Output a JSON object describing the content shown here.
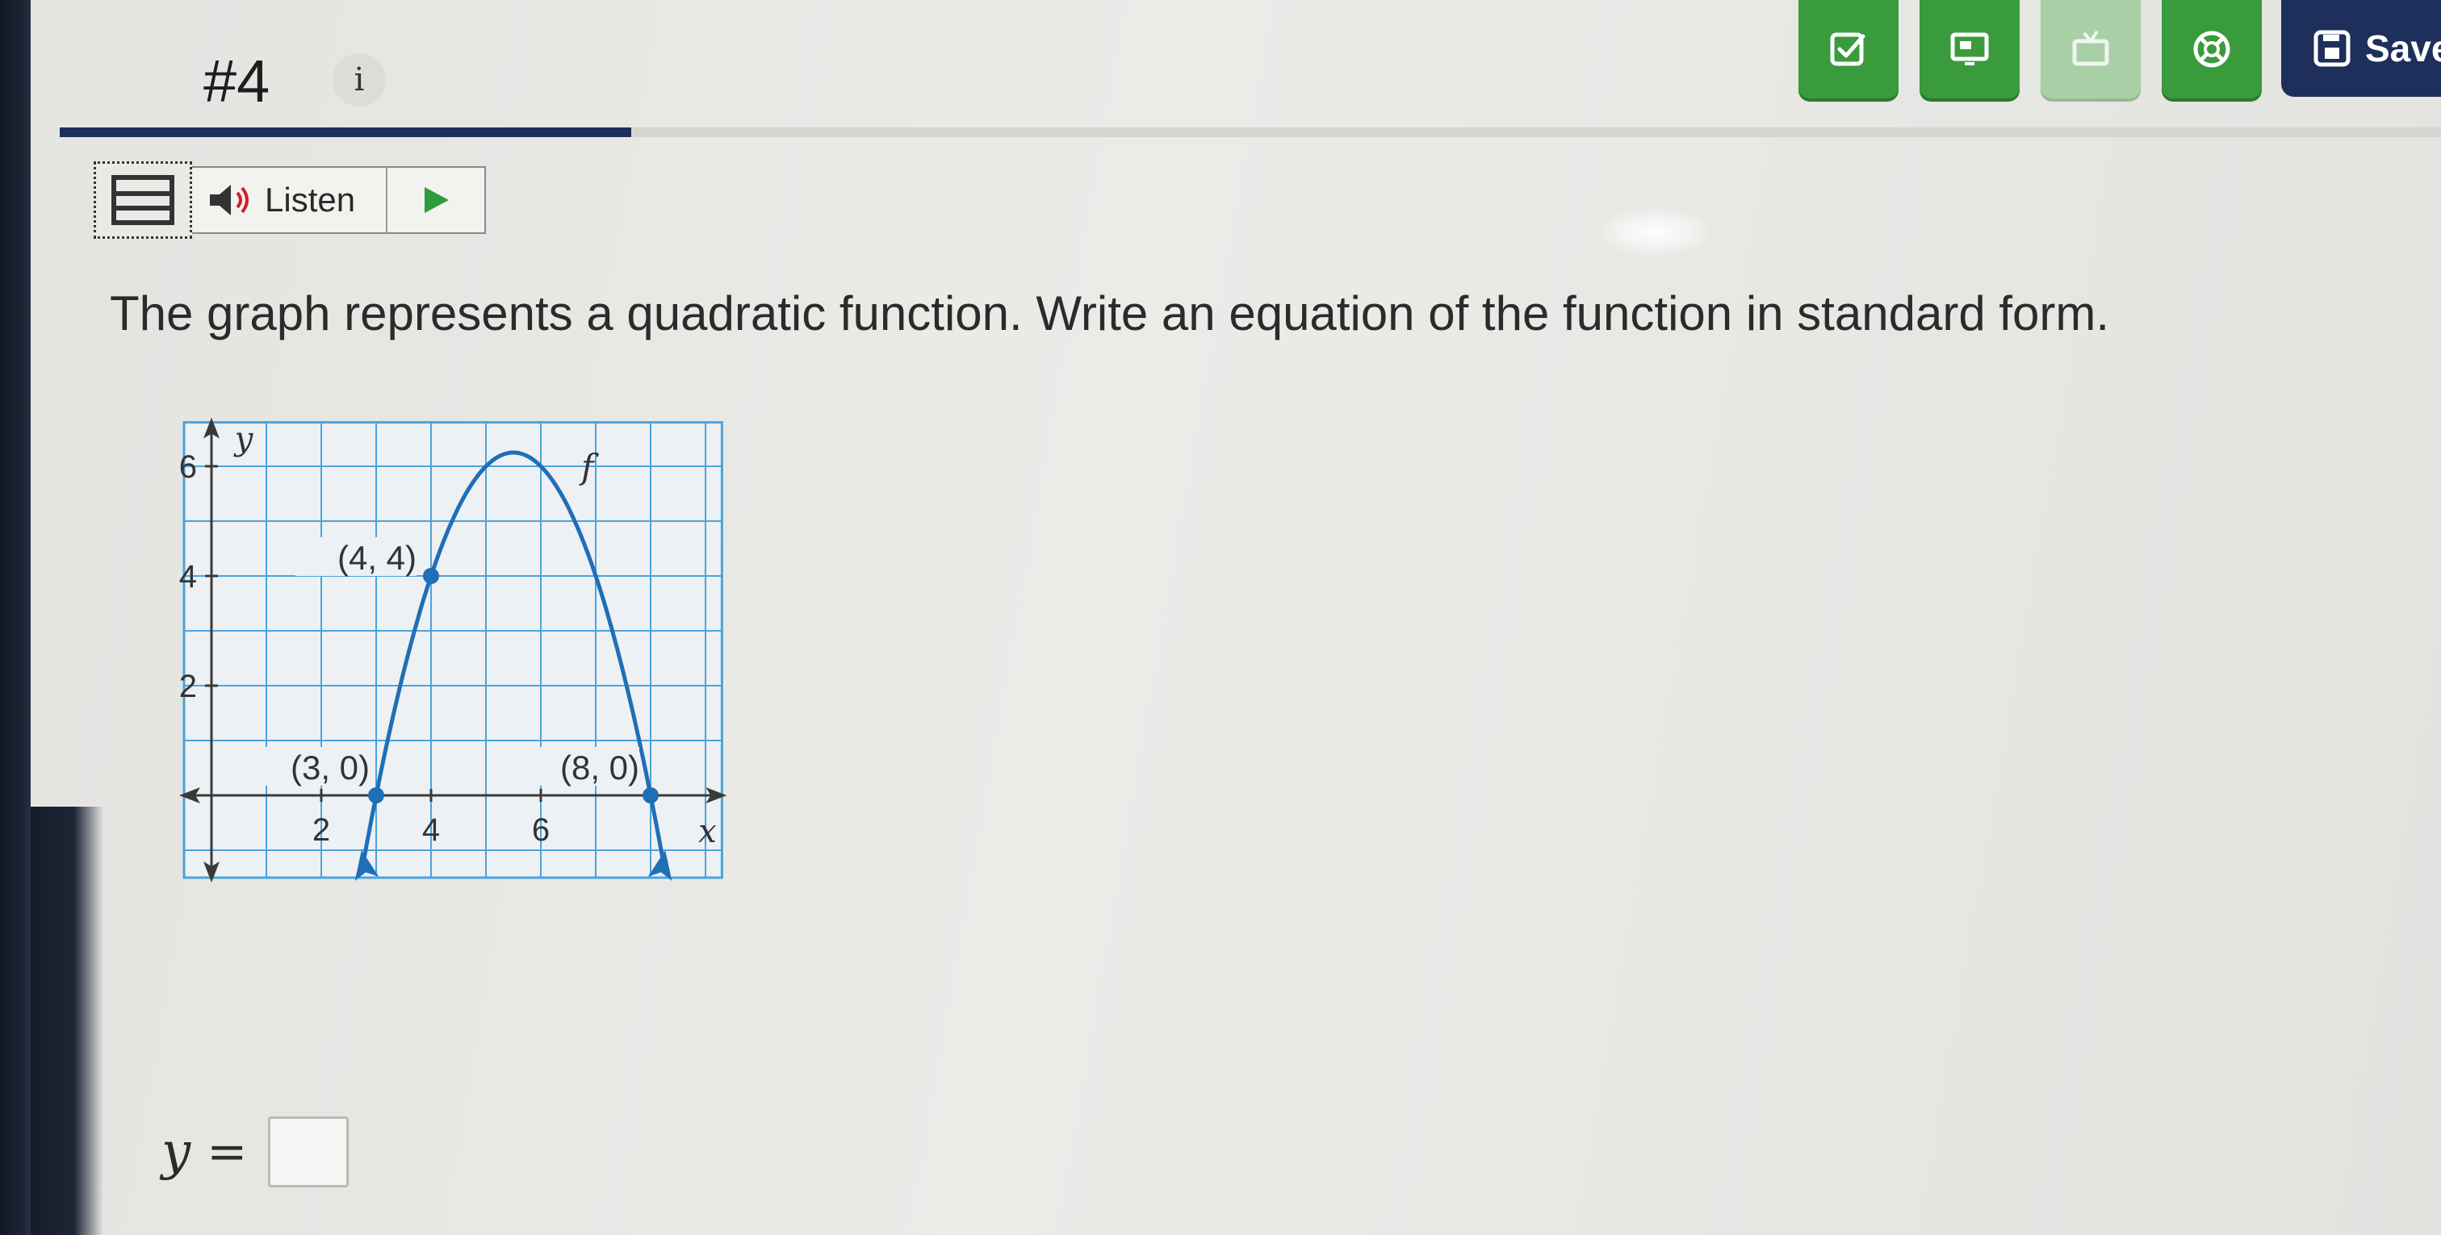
{
  "header": {
    "question_number": "#4",
    "info_badge": "i",
    "progress_fraction": 0.24,
    "tools": [
      {
        "name": "check-answer",
        "icon": "checkbox-icon",
        "enabled": true
      },
      {
        "name": "hint",
        "icon": "monitor-icon",
        "enabled": true
      },
      {
        "name": "video",
        "icon": "tv-icon",
        "enabled": false
      },
      {
        "name": "help",
        "icon": "lifebuoy-icon",
        "enabled": true
      }
    ],
    "save_label": "Save"
  },
  "listen": {
    "label": "Listen"
  },
  "question": {
    "text": "The graph represents a quadratic function. Write an equation of the function in standard form."
  },
  "graph": {
    "x_axis_label": "x",
    "y_axis_label": "y",
    "function_label": "f",
    "x_ticks": [
      "2",
      "4",
      "6"
    ],
    "y_ticks": [
      "6",
      "4",
      "2"
    ],
    "points": [
      {
        "label": "(4, 4)",
        "x": 4,
        "y": 4
      },
      {
        "label": "(3, 0)",
        "x": 3,
        "y": 0
      },
      {
        "label": "(8, 0)",
        "x": 8,
        "y": 0
      }
    ],
    "curve_color": "#1f6fb7",
    "grid_color": "#4aa3df"
  },
  "answer": {
    "variable": "y",
    "equals": "=",
    "value": ""
  },
  "colors": {
    "tool_green": "#3a9b3c",
    "navy": "#1d2f5a"
  }
}
